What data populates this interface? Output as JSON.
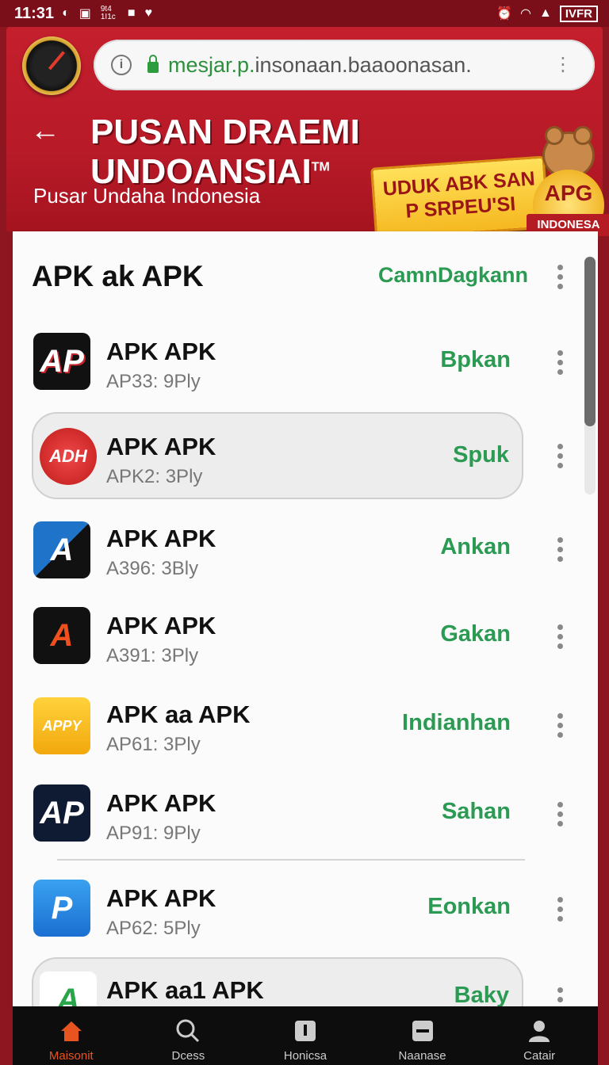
{
  "status_bar": {
    "time": "11:31",
    "carrier": "IVFR",
    "small_text": "9t4 1I1c"
  },
  "browser": {
    "url_prefix": "mesjar.p.",
    "url_rest": "insonaan.baaoonasan.",
    "lock_color": "#2e9b3f"
  },
  "header": {
    "title": "PUSAN DRAEMI UNDOANSIAI",
    "trademark": "TM",
    "subtitle": "Pusar Undaha Indonesia",
    "banner_line1": "UDUK ABK SAN",
    "banner_line2": "P SRPEU'SI",
    "badge_text": "APG",
    "badge_ribbon": "INDONESA",
    "accent_color": "#c41f2d"
  },
  "section": {
    "title": "APK ak APK",
    "action": "CamnDagkann"
  },
  "apps": [
    {
      "name": "APK APK",
      "meta": "AP33: 9Ply",
      "action": "Bpkan",
      "icon": "apk-logo-black",
      "icon_text": "AP"
    },
    {
      "name": "APK APK",
      "meta": "APK2: 3Ply",
      "action": "Spuk",
      "icon": "adh-red-circle",
      "icon_text": "ADH"
    },
    {
      "name": "APK APK",
      "meta": "A396: 3Bly",
      "action": "Ankan",
      "icon": "a-blue-black",
      "icon_text": "A"
    },
    {
      "name": "APK APK",
      "meta": "A391: 3Ply",
      "action": "Gakan",
      "icon": "apk-logo-orange",
      "icon_text": "A"
    },
    {
      "name": "APK aa APK",
      "meta": "AP61: 3Ply",
      "action": "Indianhan",
      "icon": "appy-yellow",
      "icon_text": "APPY"
    },
    {
      "name": "APK APK",
      "meta": "AP91: 9Ply",
      "action": "Sahan",
      "icon": "apk-logo-navy",
      "icon_text": "AP"
    },
    {
      "name": "APK APK",
      "meta": "AP62: 5Ply",
      "action": "Eonkan",
      "icon": "p-gear-blue",
      "icon_text": "P"
    },
    {
      "name": "APK aa1 APK",
      "meta": "",
      "action": "Baky",
      "icon": "a-triangle-color",
      "icon_text": "A"
    }
  ],
  "bottom_nav": [
    {
      "label": "Maisonit",
      "icon": "home-icon"
    },
    {
      "label": "Dcess",
      "icon": "search-icon"
    },
    {
      "label": "Honicsa",
      "icon": "info-icon"
    },
    {
      "label": "Naanase",
      "icon": "minus-box-icon"
    },
    {
      "label": "Catair",
      "icon": "user-icon"
    }
  ]
}
